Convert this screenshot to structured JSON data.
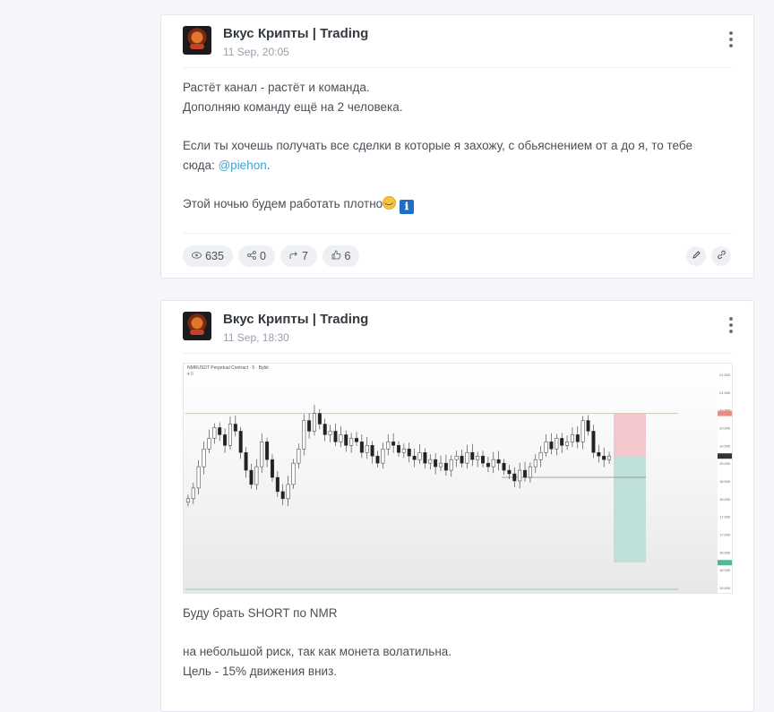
{
  "posts": [
    {
      "channel": "Вкус Крипты | Trading",
      "date": "11 Sep, 20:05",
      "lines": [
        "Растёт канал - растёт и команда.",
        "Дополняю команду ещё на 2 человека.",
        "",
        "Если ты хочешь получать все сделки в которые я захожу, с обьяснением от а до я, то тебе",
        "сюда: ",
        "",
        "Этой ночью будем работать плотно"
      ],
      "mention": "@piehon",
      "mention_suffix": ".",
      "emoji_info": "ℹ",
      "stats": {
        "views": "635",
        "shares": "0",
        "forwards": "7",
        "reactions": "6"
      },
      "icons": {
        "views": "eye-icon",
        "shares": "share-icon",
        "forwards": "forward-icon",
        "reactions": "thumbs-up-icon",
        "edit": "pencil-icon",
        "link": "link-icon"
      }
    },
    {
      "channel": "Вкус Крипты | Trading",
      "date": "11 Sep, 18:30",
      "chart_header": "NMRUSDT Perpetual Contract · 5 · Bybit",
      "chart_subheader": "▾ 0",
      "lines": [
        "Буду брать SHORT по NMR",
        "",
        "на небольшой риск, так как монета волатильна.",
        "Цель - 15% движения вниз."
      ]
    }
  ],
  "colors": {
    "accent_link": "#3aa5d8",
    "stop_zone": "#f4c7cd",
    "target_zone": "#bfe0d8",
    "level_line": "#f5c46a",
    "candle_up": "#ffffff",
    "candle_down": "#222222"
  },
  "chart_data": {
    "type": "candlestick",
    "title": "",
    "y_tick_labels": [
      "21.500",
      "21.000",
      "20.500",
      "20.000",
      "19.500",
      "19.000",
      "18.500",
      "18.000",
      "17.500",
      "17.000",
      "16.500",
      "16.000",
      "15.500"
    ],
    "ylim": [
      15.4,
      21.7
    ],
    "close_series": [
      18.0,
      18.3,
      18.9,
      19.4,
      19.7,
      20.0,
      19.8,
      19.5,
      20.1,
      19.9,
      19.3,
      18.8,
      18.4,
      18.9,
      19.6,
      19.1,
      18.6,
      18.2,
      18.0,
      18.4,
      19.0,
      19.4,
      20.2,
      19.9,
      20.4,
      20.1,
      19.8,
      19.9,
      19.6,
      19.8,
      19.5,
      19.7,
      19.6,
      19.3,
      19.5,
      19.2,
      19.0,
      19.4,
      19.6,
      19.5,
      19.3,
      19.4,
      19.2,
      19.1,
      19.3,
      19.0,
      19.1,
      18.9,
      19.0,
      18.8,
      19.1,
      19.2,
      19.0,
      19.3,
      19.1,
      19.2,
      19.0,
      18.9,
      19.1,
      19.0,
      18.8,
      18.7,
      18.5,
      18.8,
      18.6,
      18.9,
      19.1,
      19.3,
      19.6,
      19.4,
      19.7,
      19.5,
      19.6,
      19.8,
      19.6,
      20.2,
      19.9,
      19.3,
      19.2,
      19.1,
      19.2
    ],
    "entry_level": 20.4,
    "stop_zone": [
      20.4,
      19.2
    ],
    "target_zone": [
      19.2,
      16.2
    ],
    "support_level": 18.6
  }
}
